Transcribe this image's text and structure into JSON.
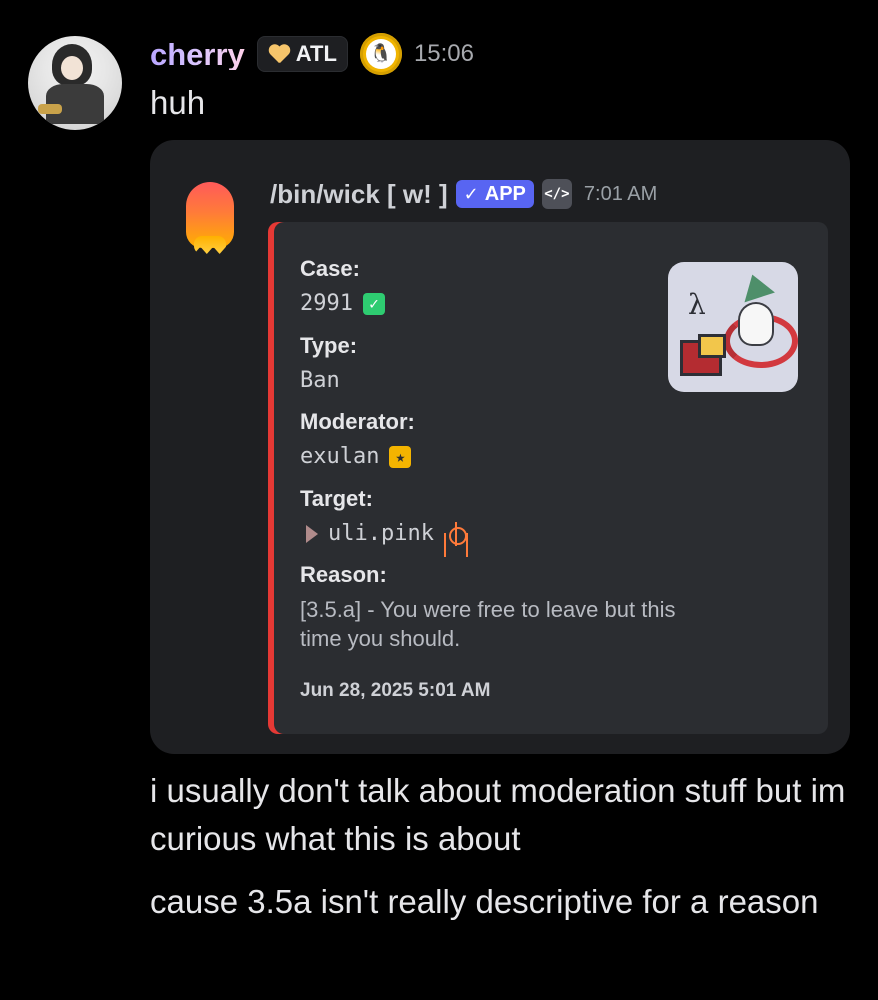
{
  "message": {
    "username": "cherry",
    "tag_label": "ATL",
    "badge_icon": "linux-badge-icon",
    "timestamp": "15:06",
    "text": "huh"
  },
  "embed": {
    "bot_name": "/bin/wick [ w! ]",
    "app_badge": "APP",
    "dev_badge": "</>",
    "time": "7:01 AM",
    "accent_color": "#e53935",
    "fields": {
      "case_label": "Case:",
      "case_value": "2991",
      "type_label": "Type:",
      "type_value": "Ban",
      "moderator_label": "Moderator:",
      "moderator_value": "exulan",
      "target_label": "Target:",
      "target_value": "uli.pink",
      "reason_label": "Reason:",
      "reason_value": "[3.5.a] - You were free to leave but this time you should.",
      "date": "Jun 28, 2025 5:01 AM"
    }
  },
  "followups": [
    "i usually don't talk about moderation stuff but im curious what this is about",
    "cause 3.5a isn't really descriptive for a reason"
  ]
}
